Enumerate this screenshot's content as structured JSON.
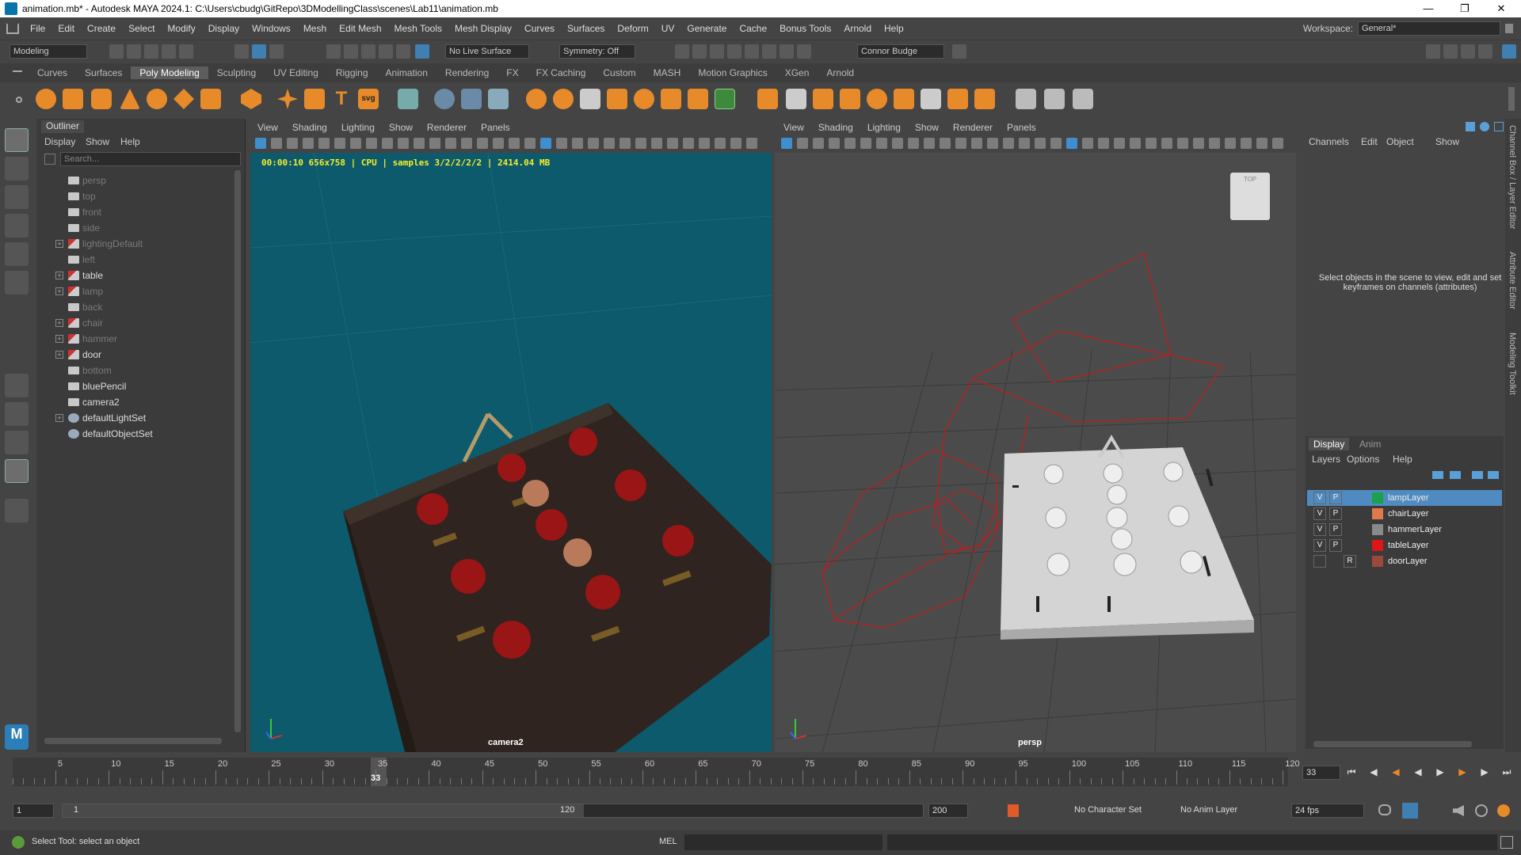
{
  "window": {
    "title": "animation.mb* - Autodesk MAYA 2024.1: C:\\Users\\cbudg\\GitRepo\\3DModellingClass\\scenes\\Lab11\\animation.mb"
  },
  "menu": [
    "File",
    "Edit",
    "Create",
    "Select",
    "Modify",
    "Display",
    "Windows",
    "Mesh",
    "Edit Mesh",
    "Mesh Tools",
    "Mesh Display",
    "Curves",
    "Surfaces",
    "Deform",
    "UV",
    "Generate",
    "Cache",
    "Bonus Tools",
    "Arnold",
    "Help"
  ],
  "workspace": {
    "label": "Workspace:",
    "value": "General*"
  },
  "statusline": {
    "mode": "Modeling",
    "live_surface": "No Live Surface",
    "symmetry": "Symmetry: Off",
    "user": "Connor Budge"
  },
  "shelf_tabs": [
    "Curves",
    "Surfaces",
    "Poly Modeling",
    "Sculpting",
    "UV Editing",
    "Rigging",
    "Animation",
    "Rendering",
    "FX",
    "FX Caching",
    "Custom",
    "MASH",
    "Motion Graphics",
    "XGen",
    "Arnold"
  ],
  "shelf_active": "Poly Modeling",
  "shelf_text_icons": {
    "text": "T",
    "svg": "svg"
  },
  "outliner": {
    "title": "Outliner",
    "menus": [
      "Display",
      "Show",
      "Help"
    ],
    "search_placeholder": "Search...",
    "items": [
      {
        "name": "persp",
        "type": "camera",
        "dim": true,
        "expand": false
      },
      {
        "name": "top",
        "type": "camera",
        "dim": true,
        "expand": false
      },
      {
        "name": "front",
        "type": "camera",
        "dim": true,
        "expand": false
      },
      {
        "name": "side",
        "type": "camera",
        "dim": true,
        "expand": false
      },
      {
        "name": "lightingDefault",
        "type": "mesh",
        "dim": true,
        "expand": true
      },
      {
        "name": "left",
        "type": "camera",
        "dim": true,
        "expand": false
      },
      {
        "name": "table",
        "type": "mesh",
        "dim": false,
        "expand": true
      },
      {
        "name": "lamp",
        "type": "mesh",
        "dim": true,
        "expand": true
      },
      {
        "name": "back",
        "type": "camera",
        "dim": true,
        "expand": false
      },
      {
        "name": "chair",
        "type": "mesh",
        "dim": true,
        "expand": true
      },
      {
        "name": "hammer",
        "type": "mesh",
        "dim": true,
        "expand": true
      },
      {
        "name": "door",
        "type": "mesh",
        "dim": false,
        "expand": true
      },
      {
        "name": "bottom",
        "type": "camera",
        "dim": true,
        "expand": false
      },
      {
        "name": "bluePencil",
        "type": "camera",
        "dim": false,
        "expand": false
      },
      {
        "name": "camera2",
        "type": "camera",
        "dim": false,
        "expand": false
      },
      {
        "name": "defaultLightSet",
        "type": "set",
        "dim": false,
        "expand": true
      },
      {
        "name": "defaultObjectSet",
        "type": "set",
        "dim": false,
        "expand": false
      }
    ]
  },
  "viewport_menus": [
    "View",
    "Shading",
    "Lighting",
    "Show",
    "Renderer",
    "Panels"
  ],
  "viewport1": {
    "hud": "00:00:10 656x758 | CPU | samples 3/2/2/2/2 | 2414.04 MB",
    "camera": "camera2"
  },
  "viewport2": {
    "camera": "persp",
    "viewcube": "TOP"
  },
  "channelbox": {
    "menus": [
      "Channels",
      "Edit",
      "Object",
      "Show"
    ],
    "hint": "Select objects in the scene to view, edit and set keyframes on channels (attributes)"
  },
  "side_tabs": [
    "Channel Box / Layer Editor",
    "Attribute Editor",
    "Modeling Toolkit"
  ],
  "layers": {
    "tabs": [
      "Display",
      "Anim"
    ],
    "menus": [
      "Layers",
      "Options",
      "Help"
    ],
    "items": [
      {
        "v": "V",
        "p": "P",
        "name": "lampLayer",
        "color": "#18a34a",
        "selected": true
      },
      {
        "v": "V",
        "p": "P",
        "name": "chairLayer",
        "color": "#e07a4a",
        "selected": false
      },
      {
        "v": "V",
        "p": "P",
        "name": "hammerLayer",
        "color": "#8a8a8a",
        "selected": false
      },
      {
        "v": "V",
        "p": "P",
        "name": "tableLayer",
        "color": "#e01515",
        "selected": false
      },
      {
        "v": "",
        "p": "R",
        "name": "doorLayer",
        "color": "#9b4a3a",
        "selected": false
      }
    ]
  },
  "timeline": {
    "ticks": [
      "5",
      "10",
      "15",
      "20",
      "25",
      "30",
      "35",
      "40",
      "45",
      "50",
      "55",
      "60",
      "65",
      "70",
      "75",
      "80",
      "85",
      "90",
      "95",
      "100",
      "105",
      "110",
      "115",
      "120"
    ],
    "current": "33",
    "current_field": "33"
  },
  "range": {
    "start": "1",
    "range_start": "1",
    "range_end": "120",
    "end": "200",
    "character_set": "No Character Set",
    "anim_layer": "No Anim Layer",
    "fps": "24 fps"
  },
  "help": {
    "text": "Select Tool: select an object",
    "mel": "MEL"
  }
}
